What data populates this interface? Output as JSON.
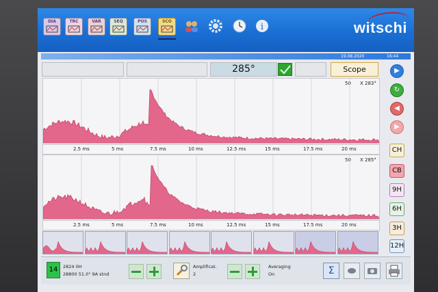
{
  "brand": {
    "name": "witschi"
  },
  "toolbar": {
    "modes": [
      {
        "label": "DIA",
        "name": "dia-mode-icon"
      },
      {
        "label": "TRC",
        "name": "trc-mode-icon"
      },
      {
        "label": "VAR",
        "name": "var-mode-icon"
      },
      {
        "label": "SEQ",
        "name": "seq-mode-icon"
      },
      {
        "label": "POS",
        "name": "pos-mode-icon"
      },
      {
        "label": "SCO",
        "name": "sco-mode-icon"
      }
    ],
    "tools": [
      "users-icon",
      "gear-icon",
      "clock-icon",
      "info-icon"
    ]
  },
  "status": {
    "date": "19.08.2020",
    "time": "16:44"
  },
  "header": {
    "angle": "285°",
    "mode_label": "Scope"
  },
  "plots": [
    {
      "scale": "50",
      "marker": "X 283°",
      "ticks": [
        "2.5 ms",
        "5 ms",
        "7.5 ms",
        "10 ms",
        "12.5 ms",
        "15 ms",
        "17.5 ms",
        "20 ms"
      ]
    },
    {
      "scale": "50",
      "marker": "X 285°",
      "ticks": [
        "2.5 ms",
        "5 ms",
        "7.5 ms",
        "10 ms",
        "12.5 ms",
        "15 ms",
        "17.5 ms",
        "20 ms"
      ]
    }
  ],
  "side_buttons": [
    {
      "label": "",
      "name": "play-button"
    },
    {
      "label": "",
      "name": "refresh-button"
    },
    {
      "label": "",
      "name": "back-button"
    },
    {
      "label": "",
      "name": "forward-button"
    },
    {
      "label": "CH",
      "name": "ch-button"
    },
    {
      "label": "CB",
      "name": "cb-button"
    },
    {
      "label": "9H",
      "name": "9h-button"
    },
    {
      "label": "6H",
      "name": "6h-button"
    },
    {
      "label": "3H",
      "name": "3h-button"
    },
    {
      "label": "12H",
      "name": "12h-button"
    }
  ],
  "bottom": {
    "count": "14",
    "line1": "2824 0H",
    "line2": "28800  51.0°  9A  stnd",
    "amp_label": "Amplificat.",
    "amp_value": "2",
    "avg_label": "Averaging",
    "avg_value": "On",
    "sigma": "Σ"
  },
  "colors": {
    "accent": "#1a6fd4",
    "trace": "#e3668b",
    "green": "#2fc04a"
  }
}
